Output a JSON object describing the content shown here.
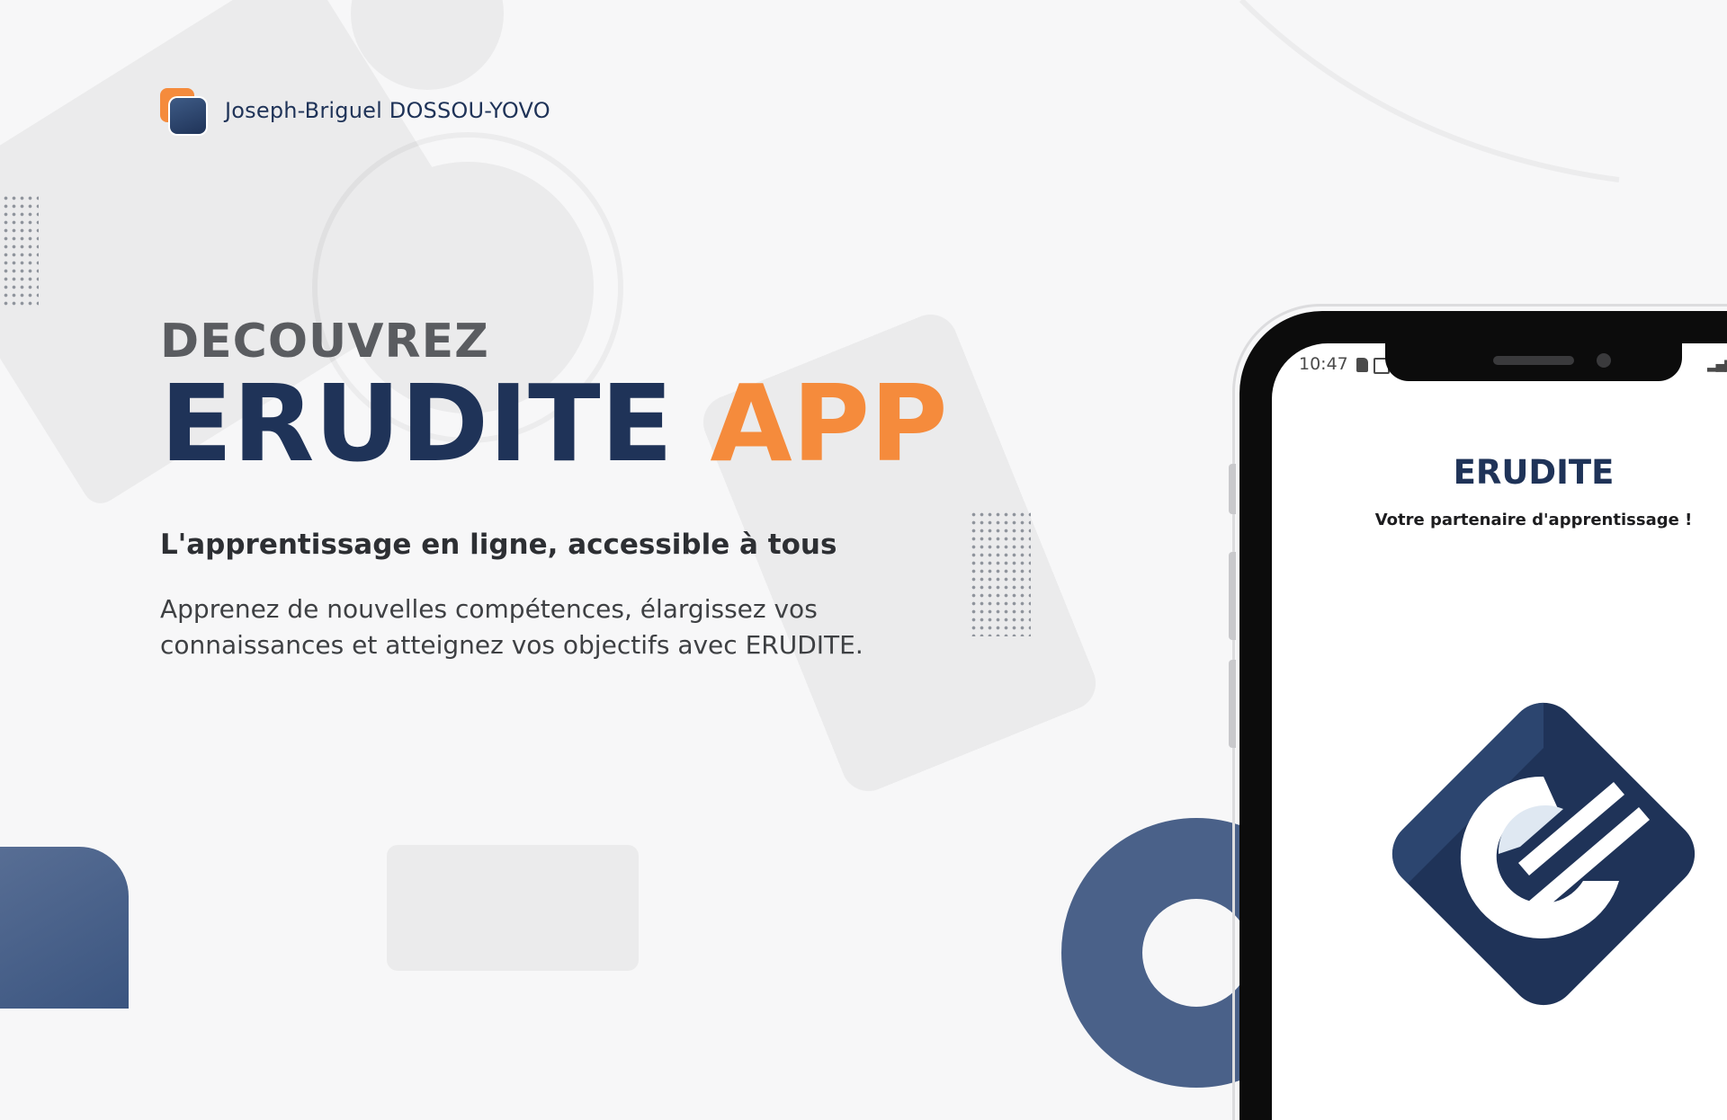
{
  "brand": {
    "name": "Joseph-Briguel DOSSOU-YOVO",
    "logo_icon": "stacked-squares-logo"
  },
  "hero": {
    "kicker": "DECOUVREZ",
    "title_primary": "ERUDITE",
    "title_accent": "APP",
    "tagline": "L'apprentissage en ligne, accessible à tous",
    "description": "Apprenez de nouvelles compétences, élargissez vos connaissances et atteignez vos objectifs avec ERUDITE."
  },
  "phone": {
    "status_bar": {
      "time": "10:47",
      "icons": [
        "sd-card-icon",
        "image-icon",
        "signal-icon",
        "battery-charging-icon"
      ]
    },
    "app": {
      "title": "ERUDITE",
      "subtitle": "Votre partenaire d'apprentissage !",
      "logo_icon": "erudite-e-logo"
    }
  },
  "colors": {
    "navy": "#1f3358",
    "orange": "#f58b3c",
    "gray_text": "#5a5c60",
    "background": "#f7f7f8"
  }
}
